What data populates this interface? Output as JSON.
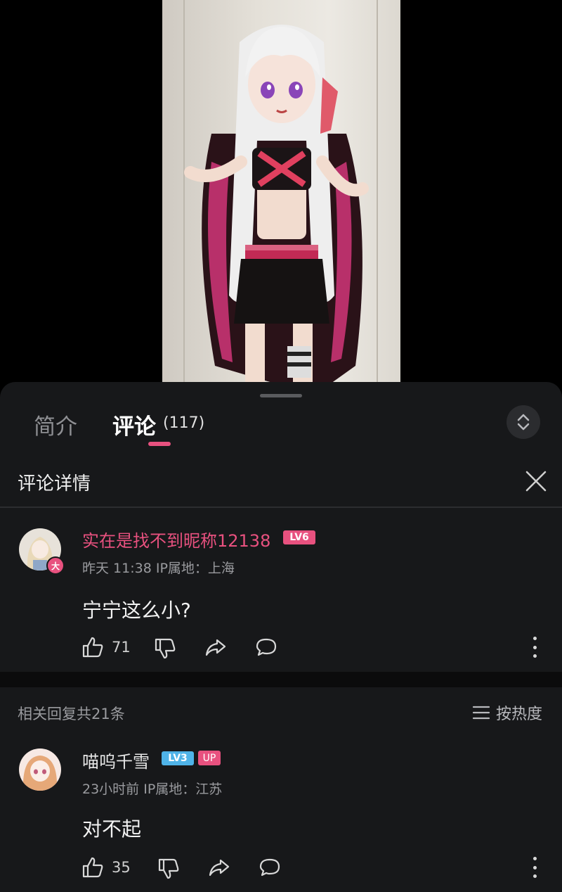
{
  "panel": {
    "tabs": [
      {
        "label": "简介",
        "active": false
      },
      {
        "label": "评论",
        "count": "(117)",
        "active": true
      }
    ],
    "detail_title": "评论详情"
  },
  "main_comment": {
    "username": "实在是找不到昵称12138",
    "level": "LV6",
    "avatar_badge": "大",
    "meta": "昨天 11:38 IP属地：上海",
    "text": "宁宁这么小?",
    "likes": "71"
  },
  "replies_header": {
    "total": "相关回复共21条",
    "sort_label": "按热度"
  },
  "reply": {
    "username": "喵呜千雪",
    "level": "LV3",
    "up_badge": "UP",
    "meta": "23小时前 IP属地：江苏",
    "text": "对不起",
    "likes": "35"
  },
  "colors": {
    "accent": "#e8517f",
    "lv3": "#4fb3e8",
    "panel_bg": "#17181a"
  }
}
